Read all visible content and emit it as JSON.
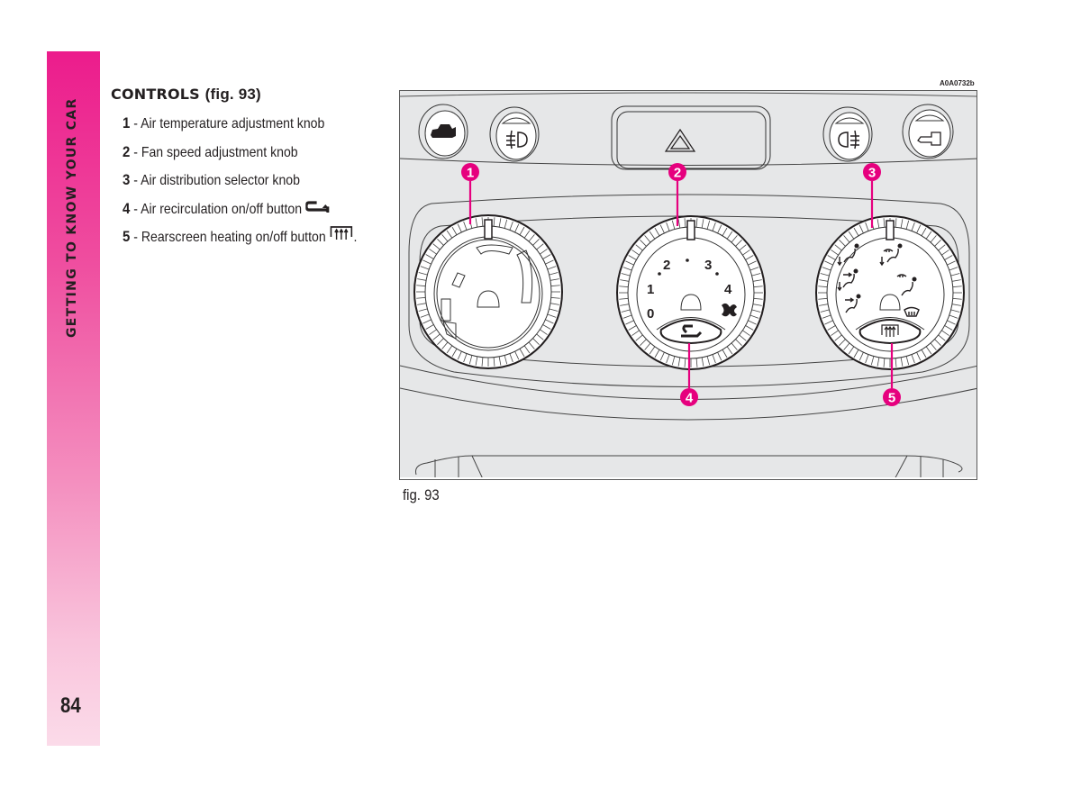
{
  "sidebar": {
    "section_title": "GETTING TO KNOW YOUR CAR",
    "page_number": "84",
    "gradient_colors": [
      "#ec1c8c",
      "#fbdbe9"
    ]
  },
  "section": {
    "heading": "CONTROLS",
    "heading_ref": "(fig. 93)",
    "items": [
      {
        "number": "1",
        "label": " - Air temperature adjustment knob",
        "icon": null
      },
      {
        "number": "2",
        "label": " - Fan speed adjustment knob",
        "icon": null
      },
      {
        "number": "3",
        "label": " - Air distribution selector knob",
        "icon": null
      },
      {
        "number": "4",
        "label": " - Air recirculation on/off button",
        "icon": "recirculation-icon"
      },
      {
        "number": "5",
        "label": " - Rearscreen heating on/off button",
        "icon": "rear-screen-heating-icon",
        "suffix": "."
      }
    ]
  },
  "figure": {
    "code": "A0A0732b",
    "caption": "fig. 93",
    "accent_color": "#e6007e",
    "top_buttons": [
      {
        "name": "boot-release",
        "icon": "car-boot-icon"
      },
      {
        "name": "front-fog-lights",
        "icon": "front-fog-light-icon"
      },
      {
        "name": "hazard-lights",
        "icon": "hazard-triangle-icon"
      },
      {
        "name": "rear-fog-light",
        "icon": "rear-fog-light-icon"
      },
      {
        "name": "key-lock",
        "icon": "key-icon"
      }
    ],
    "callouts": [
      "1",
      "2",
      "3",
      "4",
      "5"
    ],
    "fan_speed_labels": [
      "0",
      "1",
      "2",
      "3",
      "4"
    ],
    "distribution_positions": [
      "face",
      "face-feet",
      "feet",
      "feet-defrost",
      "defrost-face",
      "windscreen-defrost"
    ]
  }
}
